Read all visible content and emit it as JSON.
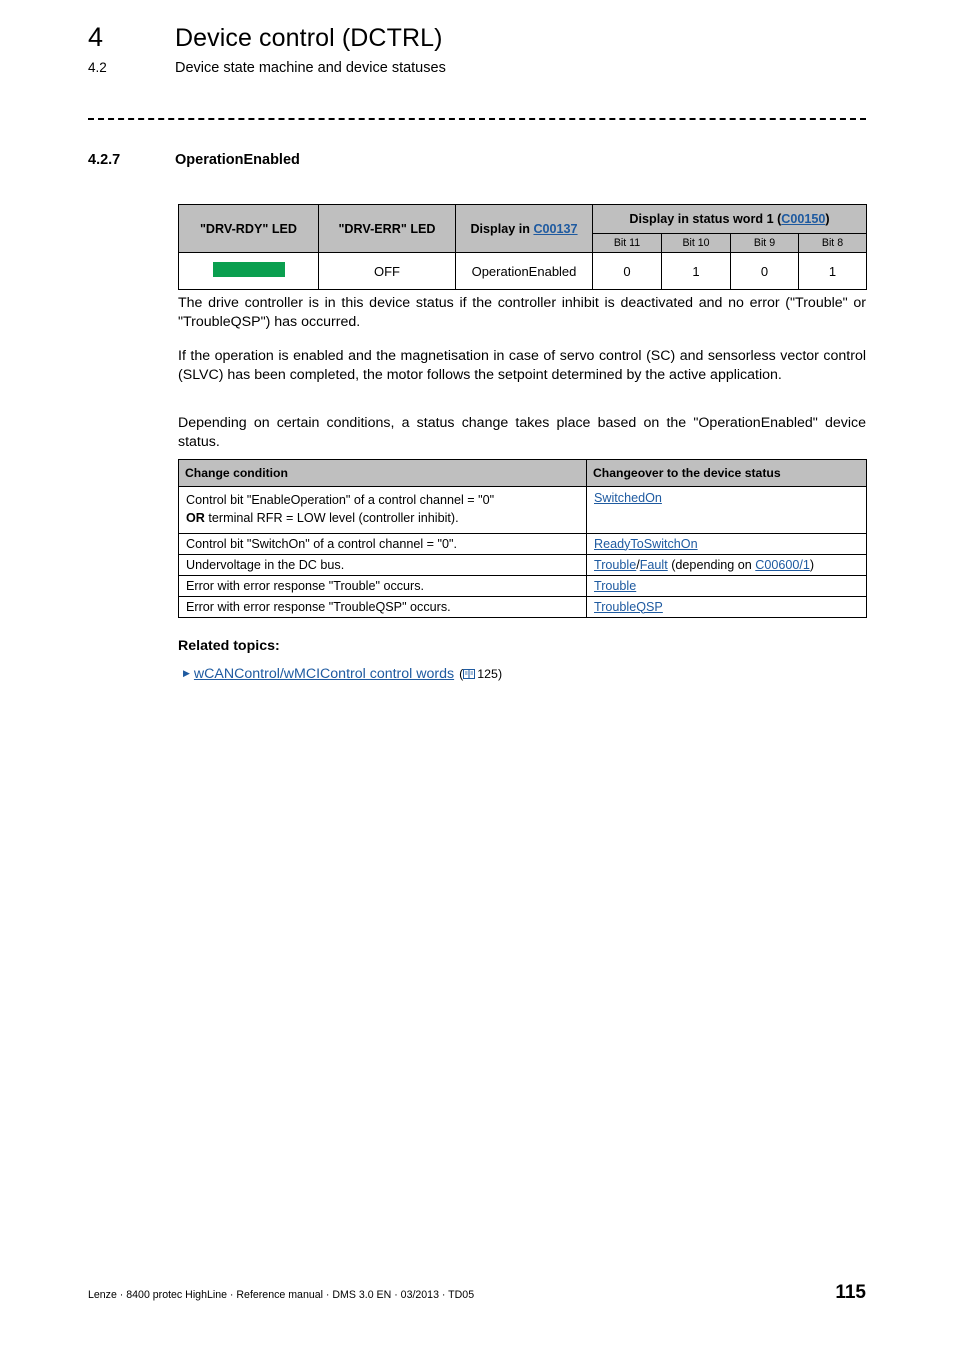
{
  "header": {
    "chapter_number": "4",
    "chapter_title": "Device control (DCTRL)",
    "section_number": "4.2",
    "section_title": "Device state machine and device statuses"
  },
  "section": {
    "number": "4.2.7",
    "title": "OperationEnabled"
  },
  "status_table": {
    "headers": {
      "drv_rdy_led": "\"DRV-RDY\" LED",
      "drv_err_led": "\"DRV-ERR\" LED",
      "display_in_prefix": "Display in ",
      "display_in_link": "C00137",
      "status_word_prefix": "Display in status word 1 (",
      "status_word_link": "C00150",
      "status_word_suffix": ")"
    },
    "bit_headers": [
      "Bit 11",
      "Bit 10",
      "Bit 9",
      "Bit 8"
    ],
    "row": {
      "drv_rdy_led_state": "green-on",
      "drv_rdy_led_color": "#0a9f4f",
      "drv_err_led": "OFF",
      "display_in_c00137": "OperationEnabled",
      "bits": [
        "0",
        "1",
        "0",
        "1"
      ]
    }
  },
  "paragraphs": {
    "p1": "The drive controller is in this device status if the controller inhibit is deactivated and no error (\"Trouble\" or \"TroubleQSP\") has occurred.",
    "p2": "If the operation is enabled and the magnetisation in case of servo control (SC) and sensorless vector control (SLVC) has been completed, the motor follows the setpoint determined by the active application.",
    "p3": "Depending on certain conditions, a status change takes place based on the \"OperationEnabled\" device status."
  },
  "changes_table": {
    "headers": {
      "condition": "Change condition",
      "changeover": "Changeover to the device status"
    },
    "rows": [
      {
        "condition_line1": "Control bit \"EnableOperation\" of a control channel = \"0\"",
        "condition_bold": "OR",
        "condition_line2": " terminal RFR = LOW level (controller inhibit).",
        "target_link": "SwitchedOn"
      },
      {
        "condition_line1": "Control bit \"SwitchOn\" of a control channel = \"0\".",
        "target_link": "ReadyToSwitchOn"
      },
      {
        "condition_line1": "Undervoltage in the DC bus.",
        "target_link": "Trouble",
        "target_link2": "Fault",
        "target_separator": "/",
        "target_suffix_pre": " (depending on ",
        "target_link3": "C00600/1",
        "target_suffix_post": ")"
      },
      {
        "condition_line1": "Error with error response \"Trouble\" occurs.",
        "target_link": "Trouble"
      },
      {
        "condition_line1": "Error with error response \"TroubleQSP\" occurs.",
        "target_link": "TroubleQSP"
      }
    ]
  },
  "related": {
    "title": "Related topics:",
    "link_text": "wCANControl/wMCIControl control words",
    "page_ref_open": "(",
    "page_ref_number": "125",
    "page_ref_close": ")"
  },
  "footer": {
    "text": "Lenze · 8400 protec HighLine · Reference manual · DMS 3.0 EN · 03/2013 · TD05",
    "page_number": "115"
  },
  "colors": {
    "link": "#1e5aa0",
    "table_header_bg": "#bfbfbf",
    "led_green": "#0a9f4f"
  }
}
